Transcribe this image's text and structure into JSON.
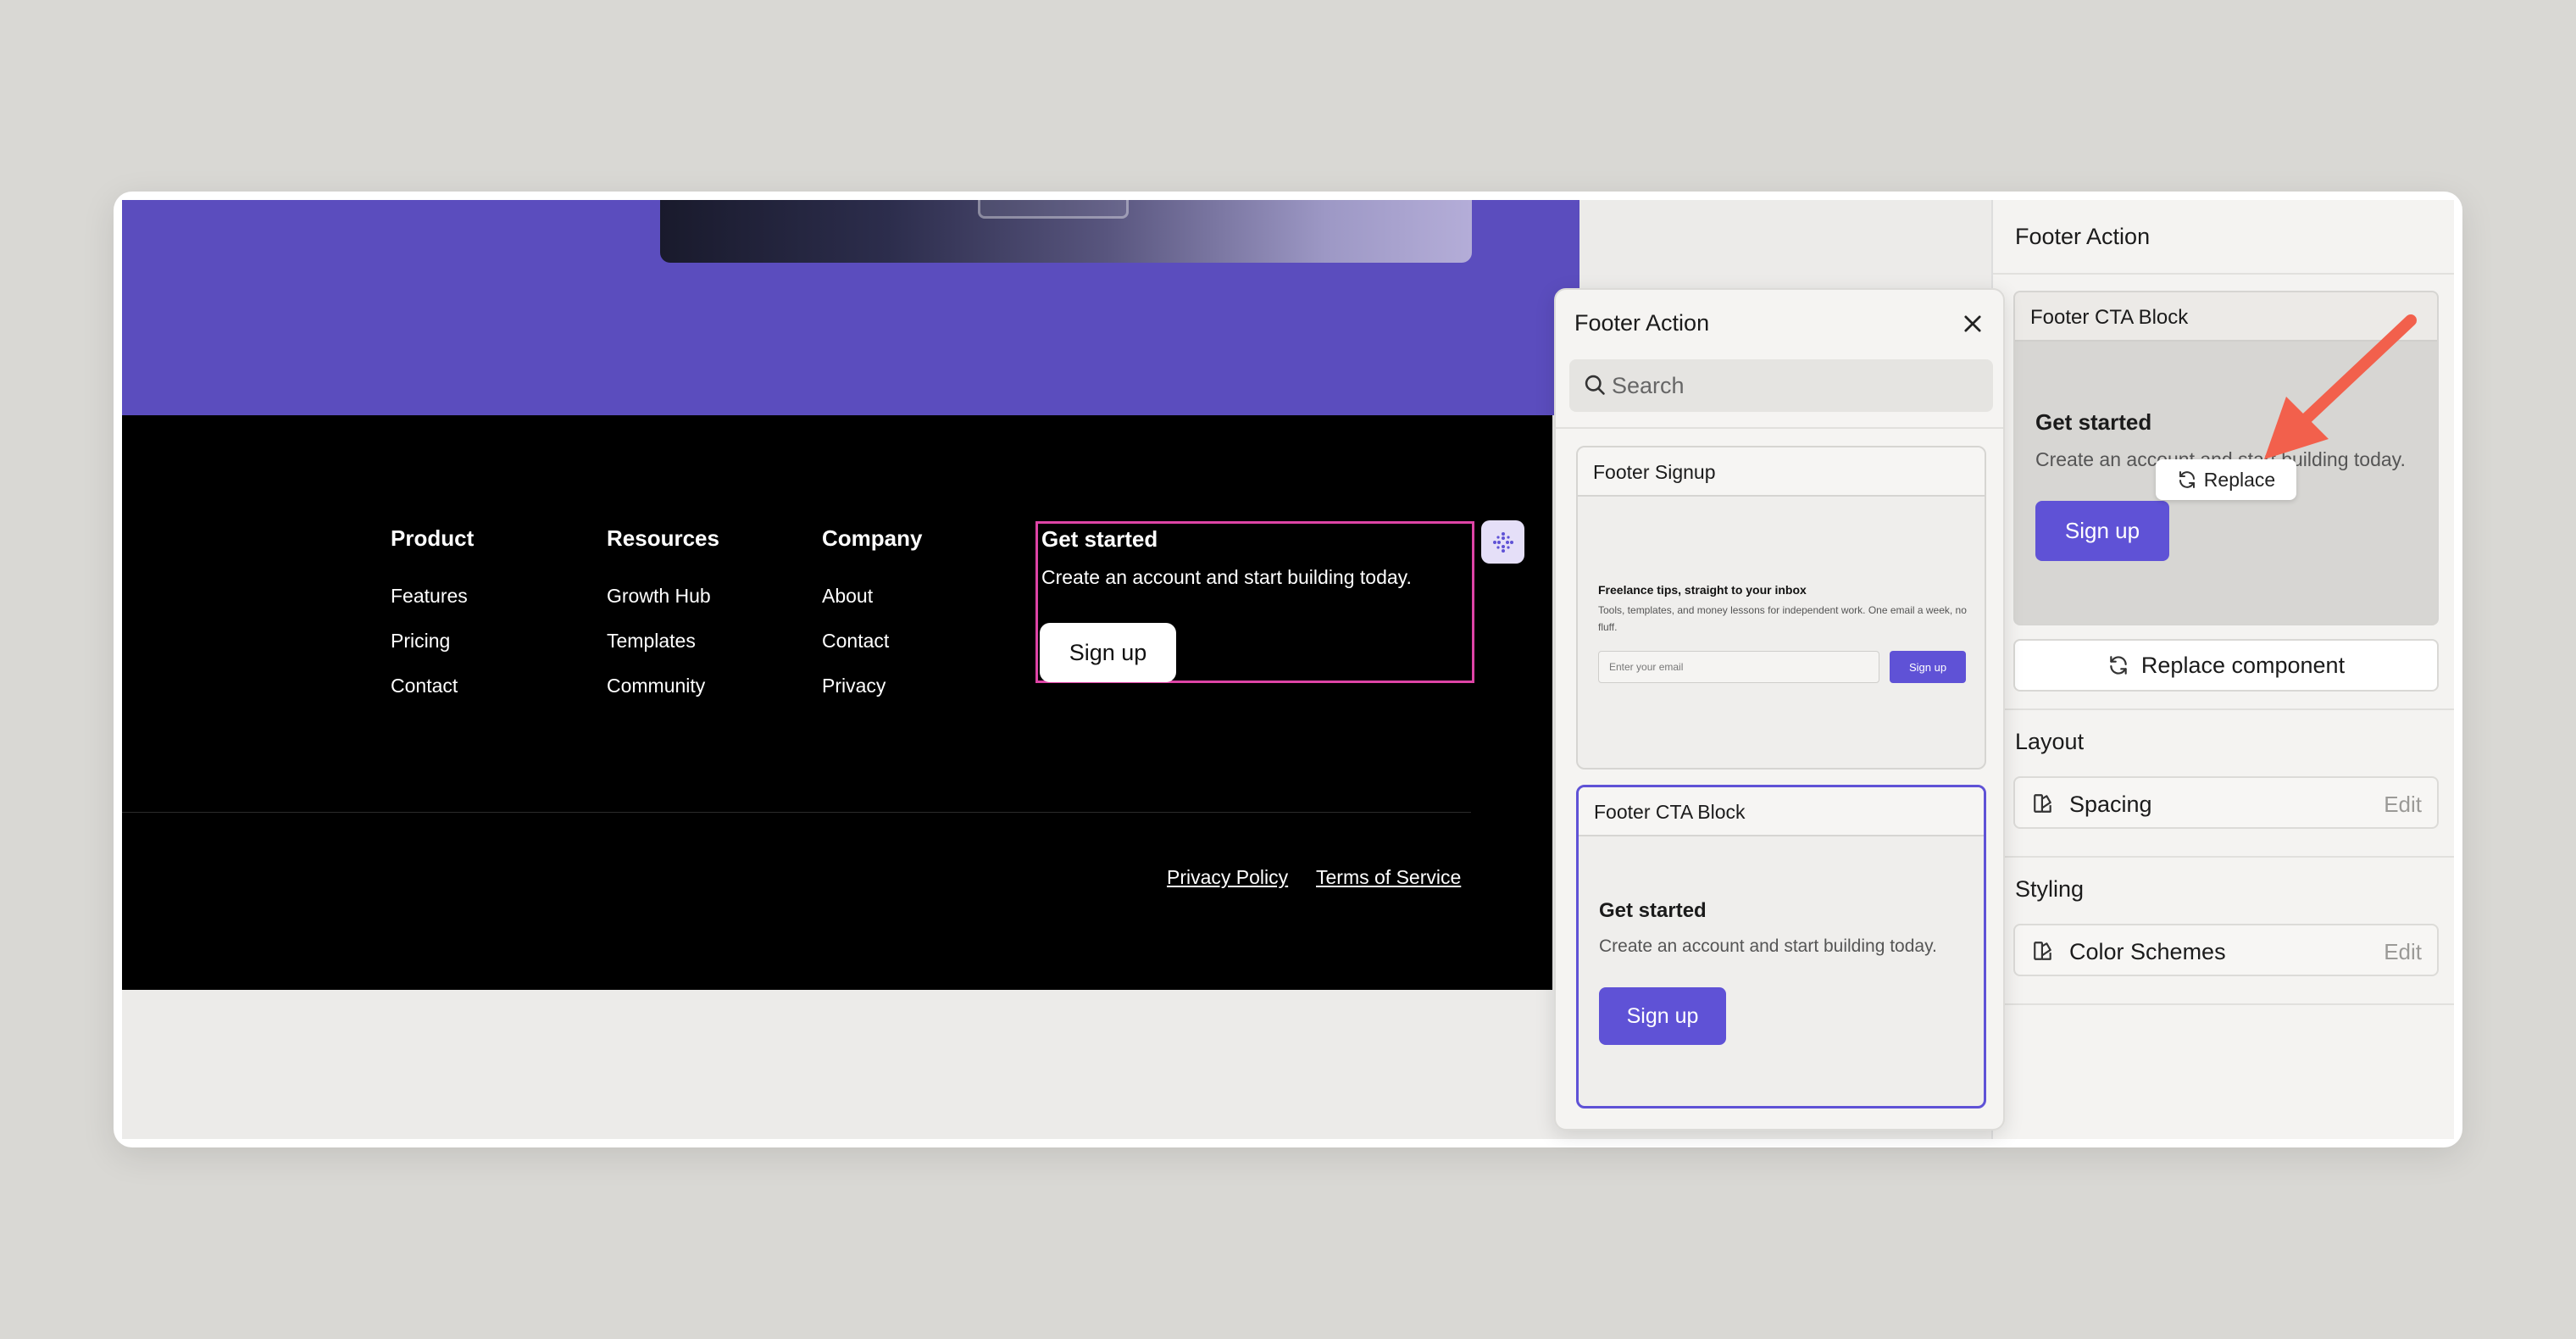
{
  "footer": {
    "columns": [
      {
        "title": "Product",
        "links": [
          "Features",
          "Pricing",
          "Contact"
        ]
      },
      {
        "title": "Resources",
        "links": [
          "Growth Hub",
          "Templates",
          "Community"
        ]
      },
      {
        "title": "Company",
        "links": [
          "About",
          "Contact",
          "Privacy"
        ]
      }
    ],
    "cta": {
      "title": "Get started",
      "description": "Create an account and start building today.",
      "button": "Sign up"
    },
    "legal": {
      "privacy": "Privacy Policy",
      "terms": "Terms of Service"
    }
  },
  "picker": {
    "title": "Footer Action",
    "search_placeholder": "Search",
    "cards": [
      {
        "name": "Footer Signup",
        "title": "Freelance tips, straight to your inbox",
        "description": "Tools, templates, and money lessons for independent work. One email a week, no fluff.",
        "input_placeholder": "Enter your email",
        "button": "Sign up"
      },
      {
        "name": "Footer CTA Block",
        "title": "Get started",
        "description": "Create an account and start building today.",
        "button": "Sign up"
      }
    ]
  },
  "inspector": {
    "title": "Footer Action",
    "preview": {
      "name": "Footer CTA Block",
      "title": "Get started",
      "description": "Create an account and start building today.",
      "button": "Sign up",
      "replace_chip": "Replace"
    },
    "replace_component": "Replace component",
    "layout": {
      "label": "Layout",
      "row": "Spacing",
      "action": "Edit"
    },
    "styling": {
      "label": "Styling",
      "row": "Color Schemes",
      "action": "Edit"
    }
  },
  "colors": {
    "accent": "#5f52d6",
    "hero": "#5b4dbe",
    "selection": "#de44a6",
    "arrow": "#f2604c"
  },
  "icons": [
    "move-handle-icon",
    "search-icon",
    "close-icon",
    "refresh-icon",
    "palette-icon",
    "arrow-icon"
  ]
}
